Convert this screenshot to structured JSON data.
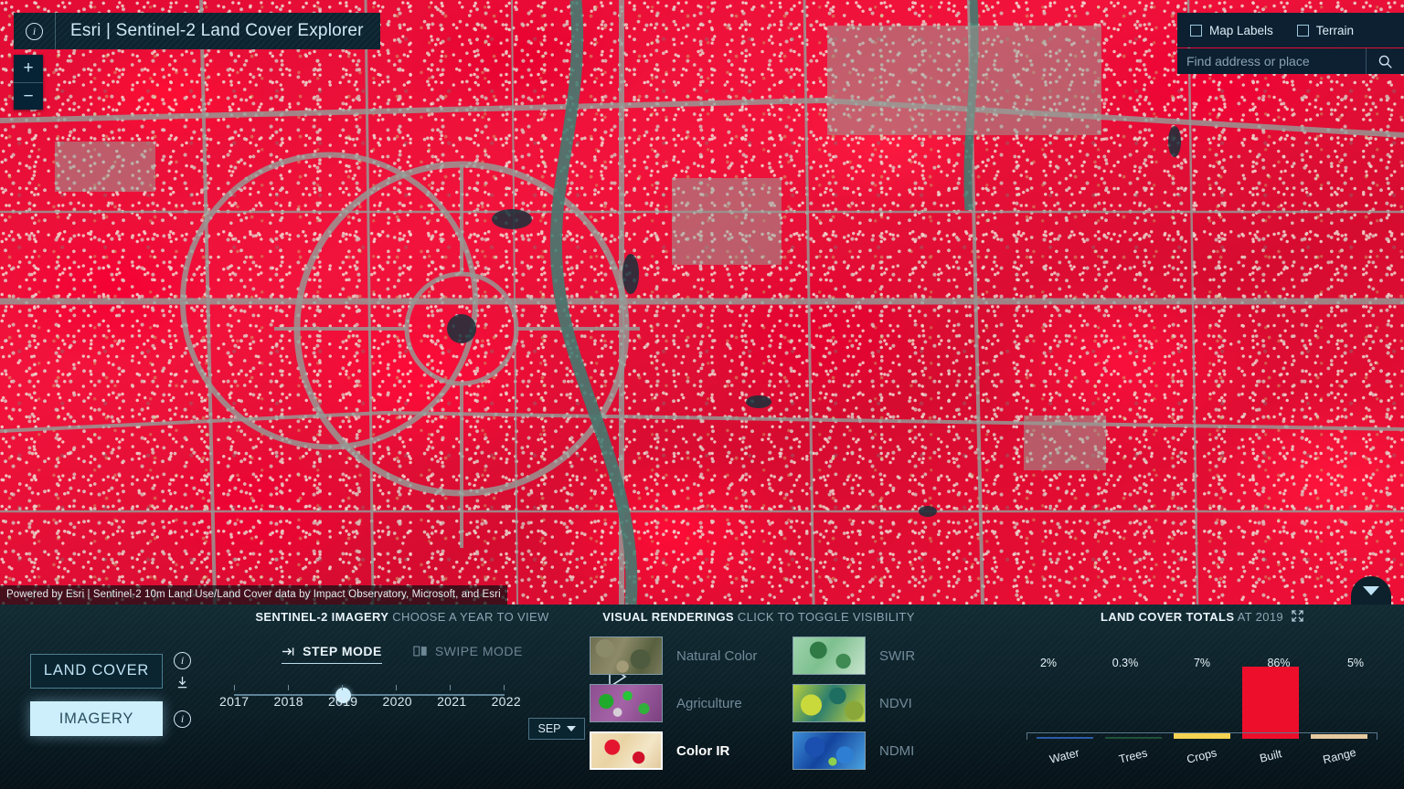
{
  "header": {
    "title": "Esri | Sentinel-2 Land Cover Explorer",
    "info_icon": "info-circle-icon"
  },
  "map": {
    "zoom_in_label": "+",
    "zoom_out_label": "−",
    "attribution": "Powered by Esri | Sentinel-2 10m Land Use/Land Cover data by Impact Observatory, Microsoft, and Esri",
    "options": [
      {
        "label": "Map Labels",
        "checked": false
      },
      {
        "label": "Terrain",
        "checked": false
      }
    ],
    "search": {
      "placeholder": "Find address or place",
      "value": "",
      "icon": "search-icon"
    },
    "panel_toggle_icon": "chevron-down-icon"
  },
  "modes": {
    "land_cover_label": "LAND COVER",
    "imagery_label": "IMAGERY",
    "active": "IMAGERY",
    "info_icon": "info-circle-icon",
    "download_icon": "download-icon"
  },
  "timeline": {
    "title_bold": "SENTINEL-2 IMAGERY",
    "title_rest": "CHOOSE A YEAR TO VIEW",
    "step_mode_label": "STEP MODE",
    "swipe_mode_label": "SWIPE MODE",
    "active_mode": "STEP MODE",
    "years": [
      "2017",
      "2018",
      "2019",
      "2020",
      "2021",
      "2022"
    ],
    "selected_year": "2019",
    "month": "SEP",
    "play_icon": "play-triangle-icon"
  },
  "renderings": {
    "title_bold": "VISUAL RENDERINGS",
    "title_rest": "CLICK TO TOGGLE VISIBILITY",
    "items": [
      {
        "label": "Natural Color",
        "active": false,
        "thumb": "th-natural"
      },
      {
        "label": "SWIR",
        "active": false,
        "thumb": "th-swir"
      },
      {
        "label": "Agriculture",
        "active": false,
        "thumb": "th-agri"
      },
      {
        "label": "NDVI",
        "active": false,
        "thumb": "th-ndvi"
      },
      {
        "label": "Color IR",
        "active": true,
        "thumb": "th-colorir"
      },
      {
        "label": "NDMI",
        "active": false,
        "thumb": "th-ndmi"
      }
    ]
  },
  "chart_panel": {
    "title_bold": "LAND COVER TOTALS",
    "title_rest": "AT 2019",
    "expand_icon": "expand-arrows-icon"
  },
  "chart_data": {
    "type": "bar",
    "title": "LAND COVER TOTALS AT 2019",
    "categories": [
      "Water",
      "Trees",
      "Crops",
      "Built",
      "Range"
    ],
    "values": [
      2,
      0.3,
      7,
      86,
      5
    ],
    "labels": [
      "2%",
      "0.3%",
      "7%",
      "86%",
      "5%"
    ],
    "colors": [
      "#2b5ba8",
      "#1e5238",
      "#f5d352",
      "#ed0e2c",
      "#e5c9a0"
    ],
    "ylim": [
      0,
      100
    ],
    "ylabel": "",
    "xlabel": "",
    "grid": false,
    "legend": "none"
  }
}
